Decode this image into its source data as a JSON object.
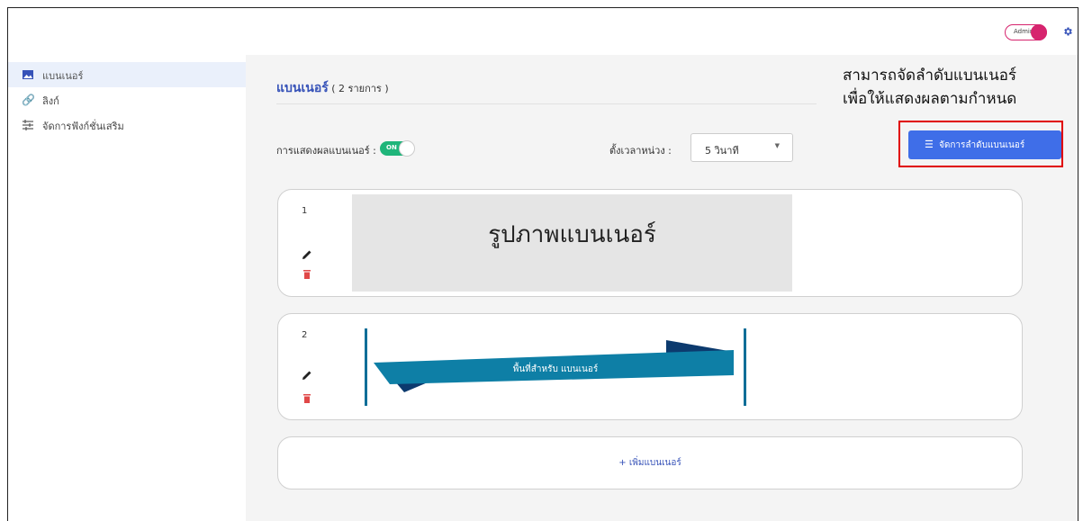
{
  "topbar": {
    "admin_label": "Admin",
    "admin_color": "#d6246e"
  },
  "sidebar": {
    "items": [
      {
        "label": "แบนเนอร์",
        "icon": "image-icon",
        "active": true
      },
      {
        "label": "ลิงก์",
        "icon": "link-icon",
        "active": false
      },
      {
        "label": "จัดการฟังก์ชั่นเสริม",
        "icon": "sliders-icon",
        "active": false
      }
    ]
  },
  "main": {
    "title": "แบนเนอร์",
    "count": " ( 2 รายการ )",
    "note_line1": "สามารถจัดลำดับแบนเนอร์",
    "note_line2": "เพื่อให้แสดงผลตามกำหนด",
    "display_label": "การแสดงผลแบนเนอร์ :",
    "switch_label": "ON",
    "interval_label": "ตั้งเวลาหน่วง :",
    "interval_value": "5 วินาที",
    "manage_button": "จัดการลำดับแบนเนอร์",
    "accent": "#3f6ee8",
    "switch_color": "#1fb57a"
  },
  "banners": [
    {
      "index": "1",
      "placeholder": "รูปภาพแบนเนอร์"
    },
    {
      "index": "2",
      "placeholder": "พื้นที่สำหรับ แบนเนอร์"
    }
  ],
  "add_banner": "+ เพิ่มแบนเนอร์"
}
